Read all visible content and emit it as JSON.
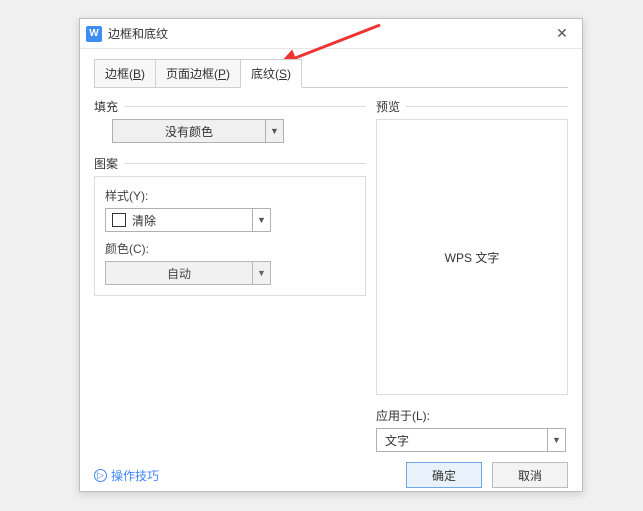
{
  "titlebar": {
    "title": "边框和底纹"
  },
  "tabs": [
    {
      "label_pre": "边框(",
      "hotkey": "B",
      "label_post": ")"
    },
    {
      "label_pre": "页面边框(",
      "hotkey": "P",
      "label_post": ")"
    },
    {
      "label_pre": "底纹(",
      "hotkey": "S",
      "label_post": ")"
    }
  ],
  "left": {
    "fill_label": "填充",
    "fill_value": "没有颜色",
    "pattern_label": "图案",
    "style_label": "样式(Y):",
    "style_value": "清除",
    "color_label": "颜色(C):",
    "color_value": "自动"
  },
  "right": {
    "preview_label": "预览",
    "preview_text": "WPS 文字",
    "apply_label": "应用于(L):",
    "apply_value": "文字"
  },
  "footer": {
    "tips": "操作技巧",
    "ok": "确定",
    "cancel": "取消"
  }
}
